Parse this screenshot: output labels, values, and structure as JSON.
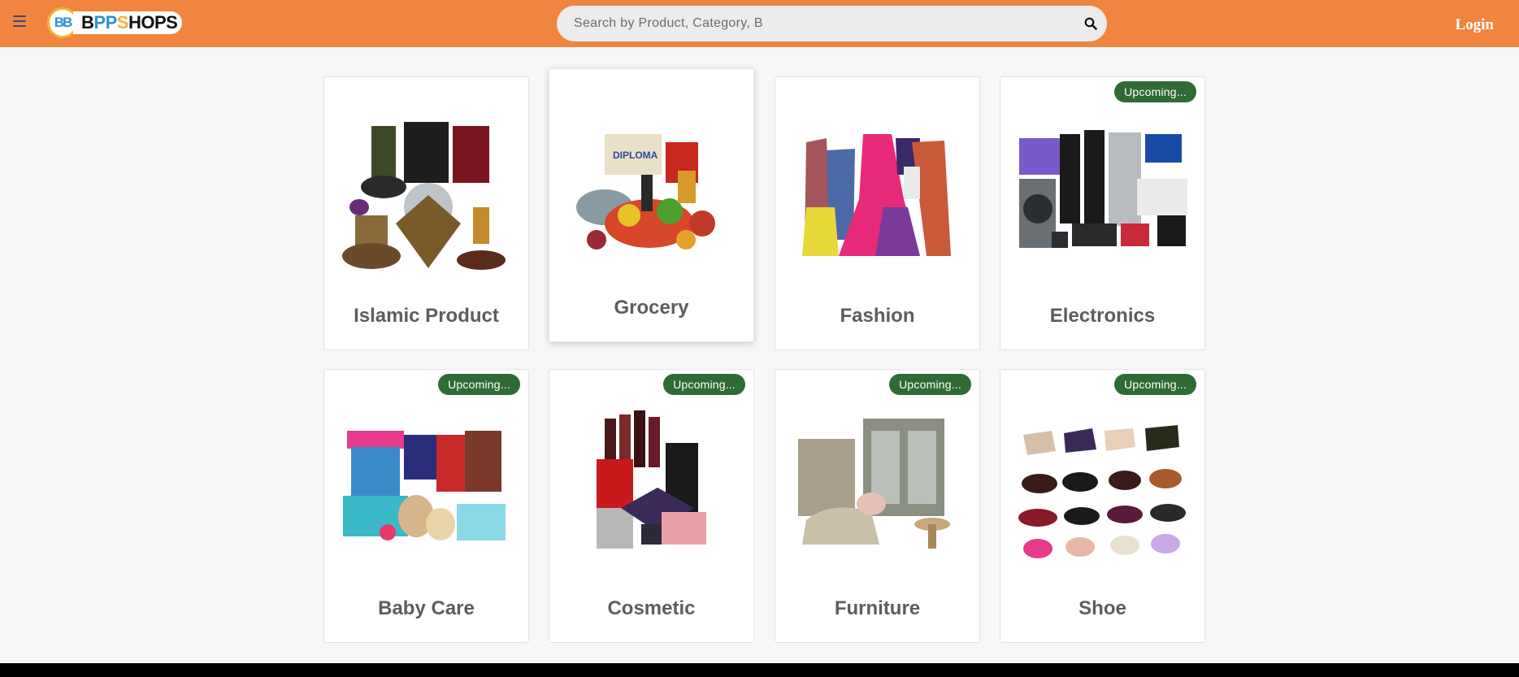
{
  "header": {
    "logo_badge": "BB",
    "logo_text_first": "B",
    "logo_text_pp": "PP",
    "logo_text_s": "S",
    "logo_text_rest": "HOPS",
    "search_placeholder": "Search by Product, Category, B",
    "login_label": "Login",
    "accent_color": "#f0853f"
  },
  "categories": [
    {
      "title": "Islamic Product",
      "badge": "",
      "icon": "islamic-product-image"
    },
    {
      "title": "Grocery",
      "badge": "",
      "icon": "grocery-image"
    },
    {
      "title": "Fashion",
      "badge": "",
      "icon": "fashion-image"
    },
    {
      "title": "Electronics",
      "badge": "Upcoming...",
      "icon": "electronics-image"
    },
    {
      "title": "Baby Care",
      "badge": "Upcoming...",
      "icon": "baby-care-image"
    },
    {
      "title": "Cosmetic",
      "badge": "Upcoming...",
      "icon": "cosmetic-image"
    },
    {
      "title": "Furniture",
      "badge": "Upcoming...",
      "icon": "furniture-image"
    },
    {
      "title": "Shoe",
      "badge": "Upcoming...",
      "icon": "shoe-image"
    }
  ],
  "colors": {
    "badge_bg": "#2f6b34",
    "title_text": "#5d5d5d",
    "page_bg": "#f7f7f7"
  }
}
